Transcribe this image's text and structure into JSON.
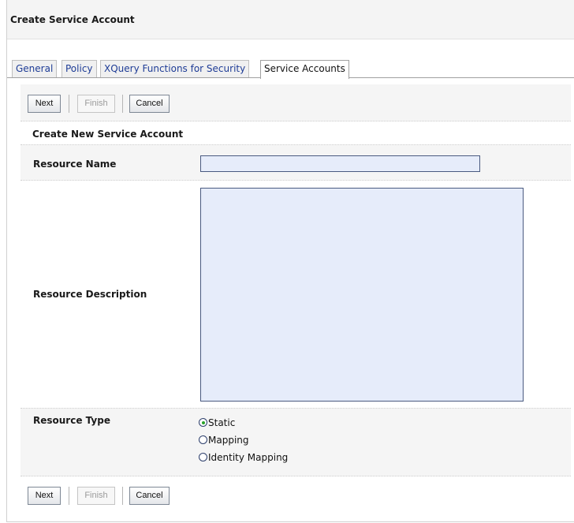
{
  "page": {
    "title": "Create Service Account"
  },
  "tabs": [
    {
      "label": "General"
    },
    {
      "label": "Policy"
    },
    {
      "label": "XQuery Functions for Security"
    },
    {
      "label": "Service Accounts",
      "active": true
    }
  ],
  "toolbar": {
    "next_label": "Next",
    "finish_label": "Finish",
    "cancel_label": "Cancel"
  },
  "form": {
    "heading": "Create New Service Account",
    "resource_name": {
      "label": "Resource Name",
      "value": ""
    },
    "resource_description": {
      "label": "Resource Description",
      "value": ""
    },
    "resource_type": {
      "label": "Resource Type",
      "options": [
        {
          "label": "Static",
          "checked": true
        },
        {
          "label": "Mapping",
          "checked": false
        },
        {
          "label": "Identity Mapping",
          "checked": false
        }
      ]
    }
  },
  "colors": {
    "input_bg": "#e6ecfa",
    "input_border": "#4a5a80",
    "tab_link": "#1e3c96",
    "radio_selected": "#27a227"
  }
}
